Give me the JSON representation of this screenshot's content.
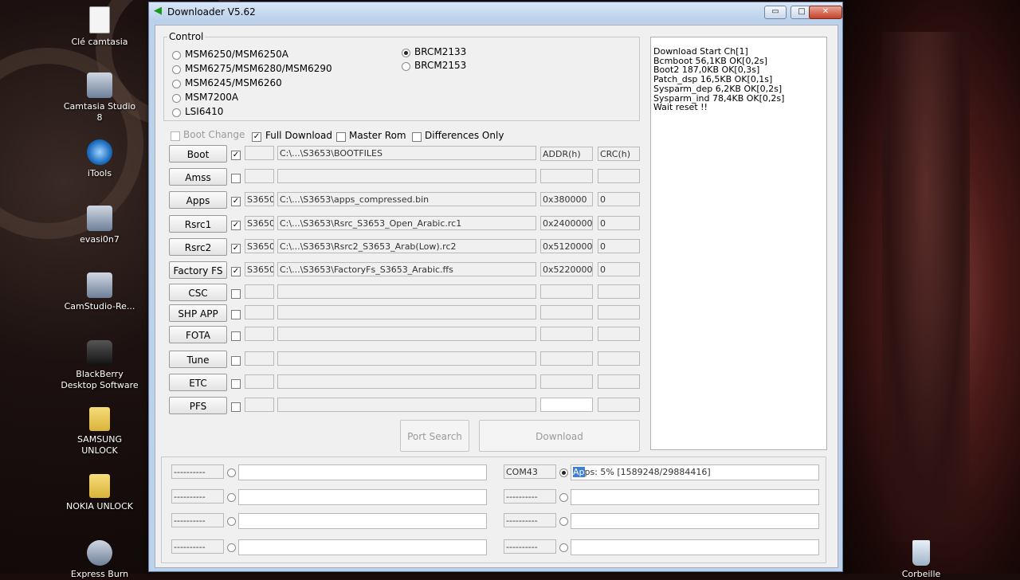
{
  "desktop": {
    "icons": [
      {
        "label": "Clé camtasia",
        "icon": "document-icon"
      },
      {
        "label": "Camtasia Studio 8",
        "icon": "camtasia-icon"
      },
      {
        "label": "iTools",
        "icon": "itools-icon"
      },
      {
        "label": "evasi0n7",
        "icon": "evasi0n-icon"
      },
      {
        "label": "CamStudio-Re...",
        "icon": "camstudio-icon"
      },
      {
        "label": "BlackBerry Desktop Software",
        "icon": "blackberry-icon"
      },
      {
        "label": "SAMSUNG UNLOCK",
        "icon": "folder-icon"
      },
      {
        "label": "NOKIA UNLOCK",
        "icon": "folder-icon"
      },
      {
        "label": "Express Burn",
        "icon": "express-burn-icon"
      }
    ],
    "right_icon": {
      "label": "Corbeille",
      "icon": "recycle-bin-icon"
    }
  },
  "window": {
    "title": "Downloader V5.62",
    "minimize": "▭",
    "maximize": "□",
    "close": "✕"
  },
  "control": {
    "label": "Control",
    "chip_left": [
      "MSM6250/MSM6250A",
      "MSM6275/MSM6280/MSM6290",
      "MSM6245/MSM6260",
      "MSM7200A",
      "LSI6410"
    ],
    "chip_right": [
      "BRCM2133",
      "BRCM2153"
    ],
    "selected": "BRCM2133"
  },
  "options": {
    "boot_change": "Boot Change",
    "full_download": "Full Download",
    "master_rom": "Master Rom",
    "differences_only": "Differences Only"
  },
  "headers": {
    "addr": "ADDR(h)",
    "crc": "CRC(h)"
  },
  "rows": [
    {
      "label": "Boot",
      "checked": true,
      "name": "",
      "path": "C:\\...\\S3653\\BOOTFILES",
      "addr": "",
      "crc": ""
    },
    {
      "label": "Amss",
      "checked": false,
      "name": "",
      "path": "",
      "addr": "",
      "crc": ""
    },
    {
      "label": "Apps",
      "checked": true,
      "name": "S3650",
      "path": "C:\\...\\S3653\\apps_compressed.bin",
      "addr": "0x380000",
      "crc": "0"
    },
    {
      "label": "Rsrc1",
      "checked": true,
      "name": "S3650",
      "path": "C:\\...\\S3653\\Rsrc_S3653_Open_Arabic.rc1",
      "addr": "0x2400000",
      "crc": "0"
    },
    {
      "label": "Rsrc2",
      "checked": true,
      "name": "S3650",
      "path": "C:\\...\\S3653\\Rsrc2_S3653_Arab(Low).rc2",
      "addr": "0x5120000",
      "crc": "0"
    },
    {
      "label": "Factory FS",
      "checked": true,
      "name": "S3650",
      "path": "C:\\...\\S3653\\FactoryFs_S3653_Arabic.ffs",
      "addr": "0x5220000",
      "crc": "0"
    },
    {
      "label": "CSC",
      "checked": false,
      "name": "",
      "path": "",
      "addr": "",
      "crc": ""
    },
    {
      "label": "SHP APP",
      "checked": false,
      "name": "",
      "path": "",
      "addr": "",
      "crc": ""
    },
    {
      "label": "FOTA",
      "checked": false,
      "name": "",
      "path": "",
      "addr": "",
      "crc": ""
    },
    {
      "label": "Tune",
      "checked": false,
      "name": "",
      "path": "",
      "addr": "",
      "crc": ""
    },
    {
      "label": "ETC",
      "checked": false,
      "name": "",
      "path": "",
      "addr": "",
      "crc": ""
    },
    {
      "label": "PFS",
      "checked": false,
      "name": "",
      "path": "",
      "addr": "",
      "crc": ""
    }
  ],
  "buttons": {
    "port_search": "Port Search",
    "download": "Download"
  },
  "log": [
    "Download Start Ch[1]",
    "Bcmboot 56,1KB OK[0,2s]",
    "Boot2 187,0KB OK[0,3s]",
    "Patch_dsp 16,5KB OK[0,1s]",
    "Sysparm_dep 6,2KB OK[0,2s]",
    "Sysparm_ind 78,4KB OK[0,2s]",
    "Wait reset !!"
  ],
  "ports": {
    "left": [
      {
        "port": "----------",
        "status": ""
      },
      {
        "port": "----------",
        "status": ""
      },
      {
        "port": "----------",
        "status": ""
      },
      {
        "port": "----------",
        "status": ""
      }
    ],
    "right": [
      {
        "port": "COM43",
        "status_hl": "Ap",
        "status": "ps:   5% [1589248/29884416]",
        "active": true
      },
      {
        "port": "----------",
        "status_hl": "",
        "status": "",
        "active": false
      },
      {
        "port": "----------",
        "status_hl": "",
        "status": "",
        "active": false
      },
      {
        "port": "----------",
        "status_hl": "",
        "status": "",
        "active": false
      }
    ]
  }
}
